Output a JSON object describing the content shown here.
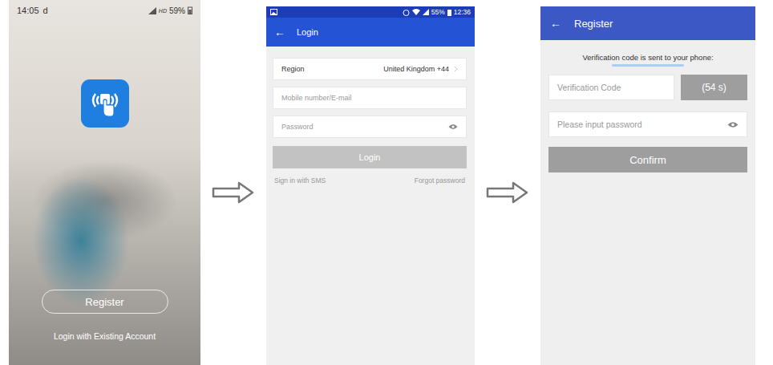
{
  "splash": {
    "status_bar": {
      "time": "14:05",
      "indicator": "d",
      "network": "HD",
      "battery": "59%"
    },
    "register_button": "Register",
    "login_link": "Login with Existing Account"
  },
  "login": {
    "status_bar": {
      "battery": "55%",
      "time": "12:36"
    },
    "header": {
      "back": "←",
      "title": "Login"
    },
    "region": {
      "label": "Region",
      "value": "United Kingdom +44"
    },
    "fields": [
      {
        "placeholder": "Mobile number/E-mail",
        "kind": "text"
      },
      {
        "placeholder": "Password",
        "kind": "password"
      }
    ],
    "login_button": {
      "label": "Login",
      "disabled": true
    },
    "links": [
      "Sign in with SMS",
      "Forgot password"
    ]
  },
  "register": {
    "header": {
      "back": "←",
      "title": "Register"
    },
    "notice": "Verification code is sent to your phone:",
    "code_field": {
      "placeholder": "Verification Code"
    },
    "countdown": {
      "label": "(54 s)",
      "disabled": true
    },
    "fields": [
      {
        "placeholder": "Please input password",
        "kind": "password"
      }
    ],
    "confirm_button": {
      "label": "Confirm",
      "disabled": true
    }
  }
}
